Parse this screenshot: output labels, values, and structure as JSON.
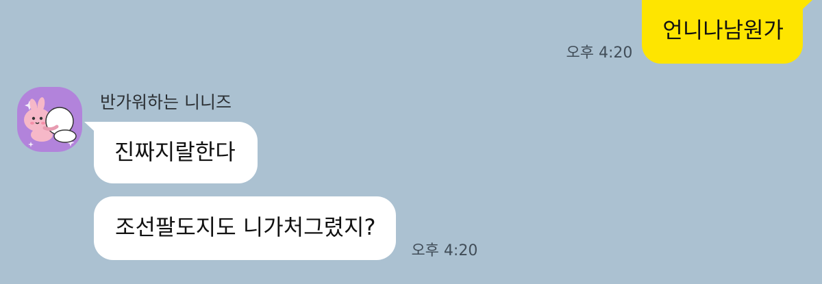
{
  "messages": {
    "sent": {
      "text": "언니나남원가",
      "time": "오후 4:20"
    },
    "received": {
      "sender_name": "반가워하는 니니즈",
      "avatar_icon": "bunny-hugging-pillow-icon",
      "items": [
        {
          "text": "진짜지랄한다"
        },
        {
          "text": "조선팔도지도 니가처그렸지?",
          "time": "오후 4:20"
        }
      ]
    }
  },
  "colors": {
    "background": "#abc1d1",
    "sent_bubble": "#fee500",
    "received_bubble": "#ffffff",
    "avatar_background": "#b283db",
    "timestamp_text": "#414d58"
  }
}
